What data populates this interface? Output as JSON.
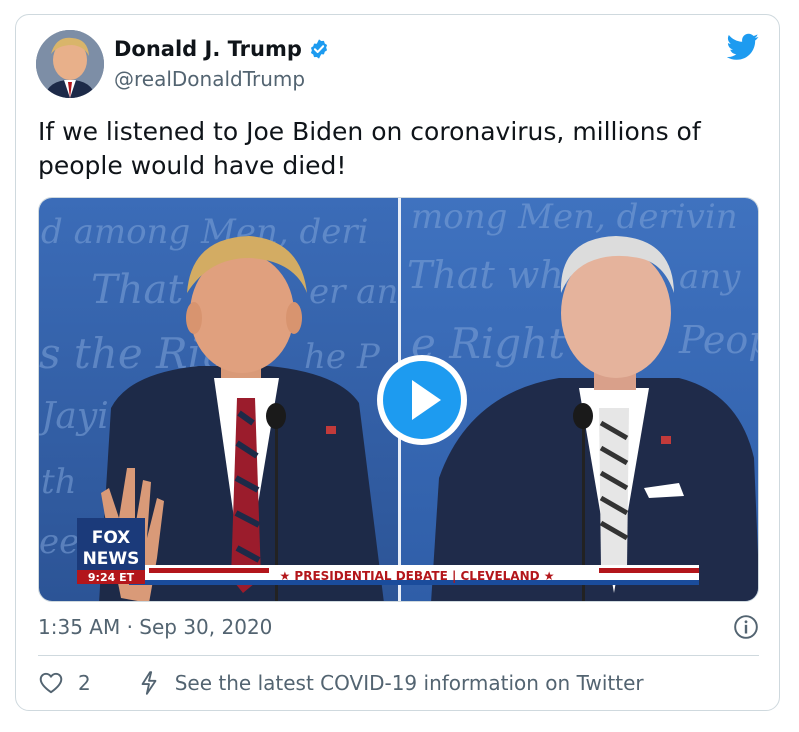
{
  "author": {
    "display_name": "Donald J. Trump",
    "handle": "@realDonaldTrump",
    "verified": true
  },
  "tweet": {
    "text": "If we listened to Joe Biden on coronavirus, millions of people would have died!"
  },
  "media": {
    "background_script_left": [
      "d among Men, deri",
      "That",
      "er an",
      "s the Rig",
      "he P",
      "Jayi",
      "th",
      "eer"
    ],
    "background_script_right": [
      "mong Men, derivin",
      "That whe",
      "any",
      "e Right",
      "Peopl"
    ],
    "chyron": {
      "network_line1": "FOX",
      "network_line2": "NEWS",
      "time": "9:24 ET",
      "lower_third": "★ PRESIDENTIAL DEBATE | CLEVELAND ★"
    },
    "colors": {
      "backdrop": "#2f5ea8",
      "accent_red": "#b3161b",
      "navy": "#1d2a48"
    }
  },
  "footer": {
    "timestamp": "1:35 AM · Sep 30, 2020",
    "like_count": "2",
    "covid_link": "See the latest COVID-19 information on Twitter"
  },
  "icons": {
    "brand": "twitter-bird-icon",
    "verified": "verified-badge-icon",
    "info": "info-icon",
    "like": "heart-icon",
    "covid": "lightning-icon",
    "play": "play-icon"
  },
  "theme": {
    "accent": "#1d9bf0",
    "muted": "#536471",
    "border": "#cfd9de"
  }
}
